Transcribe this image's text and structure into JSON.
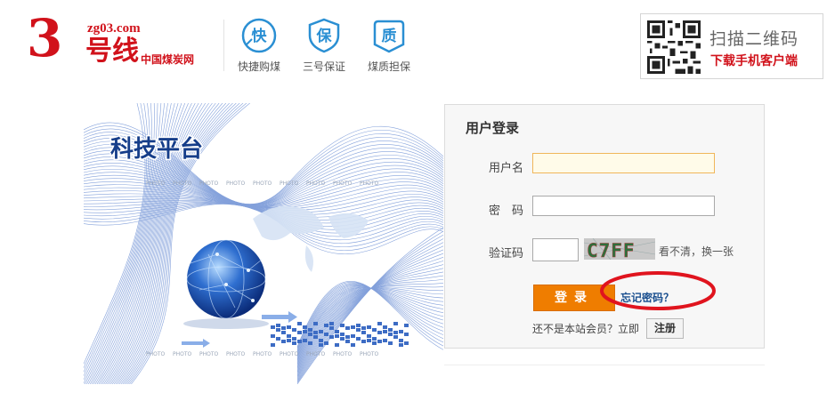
{
  "header": {
    "logo": {
      "number": "3",
      "domain": "zg03.com",
      "name": "号线",
      "subtitle": "中国煤炭网"
    },
    "features": [
      {
        "icon": "快",
        "label": "快捷购煤"
      },
      {
        "icon": "保",
        "label": "三号保证"
      },
      {
        "icon": "质",
        "label": "煤质担保"
      }
    ],
    "qr": {
      "line1": "扫描二维码",
      "line2": "下载手机客户端"
    }
  },
  "banner": {
    "title": "科技平台",
    "watermark": "PHOTO"
  },
  "login": {
    "title": "用户登录",
    "username_label": "用户名",
    "username_value": "",
    "password_label": "密　码",
    "password_value": "",
    "captcha_label": "验证码",
    "captcha_value": "",
    "captcha_text": "C7FF",
    "refresh_text": "看不清，换一张",
    "login_button": "登录",
    "forgot_link": "忘记密码？",
    "register_prompt": "还不是本站会员？立即",
    "register_button": "注册"
  },
  "colors": {
    "brand_red": "#d1121b",
    "accent_orange": "#ef7d00",
    "link_blue": "#1a4f8f",
    "icon_blue": "#2a8fd3"
  }
}
